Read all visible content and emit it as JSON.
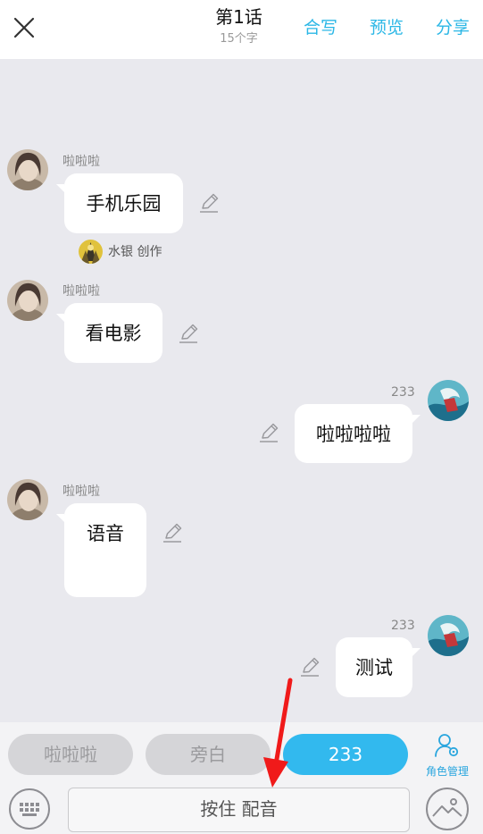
{
  "header": {
    "title": "第1话",
    "subtitle": "15个字",
    "actions": {
      "collab": "合写",
      "preview": "预览",
      "share": "分享"
    }
  },
  "messages": [
    {
      "name": "啦啦啦",
      "text": "手机乐园",
      "creator": "水银 创作"
    },
    {
      "name": "啦啦啦",
      "text": "看电影"
    },
    {
      "name": "233",
      "text": "啦啦啦啦"
    },
    {
      "name": "啦啦啦",
      "text": "语音"
    },
    {
      "name": "233",
      "text": "测试"
    }
  ],
  "toolbar": {
    "roles": [
      "啦啦啦",
      "旁白",
      "233"
    ],
    "selected_role": "233",
    "role_manage_label": "角色管理",
    "record_label": "按住 配音"
  },
  "colors": {
    "accent": "#2bb7e6",
    "selected_role_bg": "#32b9ee",
    "chat_bg": "#e9e9ee",
    "annotation_arrow": "#f01a1a"
  },
  "icons": [
    "close-icon",
    "edit-pencil-icon",
    "role-manage-icon",
    "keyboard-icon",
    "image-icon",
    "user-avatar-icon"
  ]
}
